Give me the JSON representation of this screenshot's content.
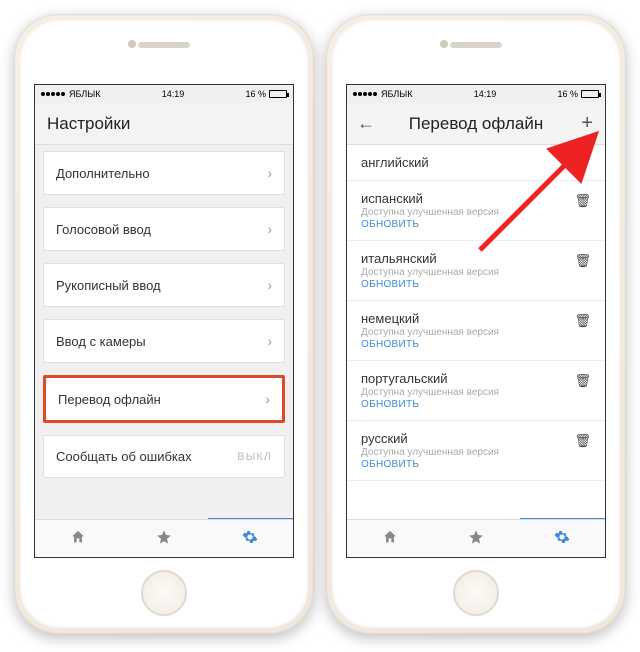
{
  "status": {
    "carrier": "ЯБЛЫК",
    "time": "14:19",
    "battery_text": "16 %"
  },
  "left": {
    "title": "Настройки",
    "items": [
      {
        "label": "Дополнительно"
      },
      {
        "label": "Голосовой ввод"
      },
      {
        "label": "Рукописный ввод"
      },
      {
        "label": "Ввод с камеры"
      },
      {
        "label": "Перевод офлайн",
        "highlight": true
      },
      {
        "label": "Сообщать об ошибках",
        "toggle": "ВЫКЛ"
      }
    ]
  },
  "right": {
    "title": "Перевод офлайн",
    "langs": [
      {
        "name": "английский"
      },
      {
        "name": "испанский",
        "sub": "Доступна улучшенная версия",
        "update": "ОБНОВИТЬ",
        "trash": true
      },
      {
        "name": "итальянский",
        "sub": "Доступна улучшенная версия",
        "update": "ОБНОВИТЬ",
        "trash": true
      },
      {
        "name": "немецкий",
        "sub": "Доступна улучшенная версия",
        "update": "ОБНОВИТЬ",
        "trash": true
      },
      {
        "name": "португальский",
        "sub": "Доступна улучшенная версия",
        "update": "ОБНОВИТЬ",
        "trash": true
      },
      {
        "name": "русский",
        "sub": "Доступна улучшенная версия",
        "update": "ОБНОВИТЬ",
        "trash": true
      }
    ]
  },
  "tabs": {
    "home": "home-icon",
    "star": "star-icon",
    "gear": "gear-icon"
  }
}
